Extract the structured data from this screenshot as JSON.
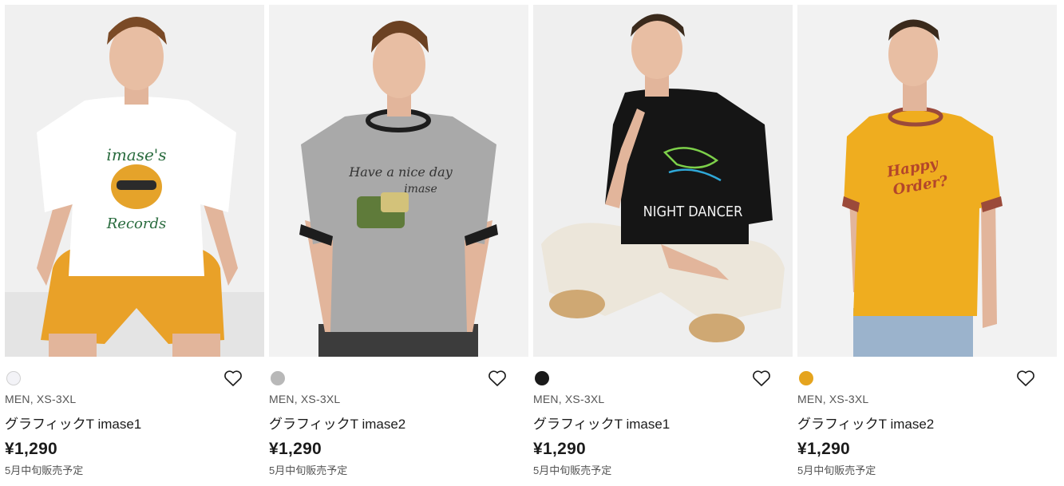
{
  "products": [
    {
      "swatch_color": "#f3f3f7",
      "gender_size": "MEN, XS-3XL",
      "name": "グラフィックT imase1",
      "price": "¥1,290",
      "status": "5月中旬販売予定",
      "image": {
        "shirt_color": "#ffffff",
        "bottom_color": "#e9a128",
        "trim_color": "#ffffff",
        "print_text": "imase's Records",
        "pose": "seated"
      }
    },
    {
      "swatch_color": "#b8b8b8",
      "gender_size": "MEN, XS-3XL",
      "name": "グラフィックT imase2",
      "price": "¥1,290",
      "status": "5月中旬販売予定",
      "image": {
        "shirt_color": "#a9a9a9",
        "bottom_color": "#3c3c3c",
        "trim_color": "#1d1d1d",
        "print_text": "Have a nice day imase",
        "pose": "standing"
      }
    },
    {
      "swatch_color": "#1a1a1a",
      "gender_size": "MEN, XS-3XL",
      "name": "グラフィックT imase1",
      "price": "¥1,290",
      "status": "5月中旬販売予定",
      "image": {
        "shirt_color": "#151515",
        "bottom_color": "#ece6da",
        "trim_color": "#151515",
        "print_text": "NIGHT DANCER",
        "pose": "cross-legged"
      }
    },
    {
      "swatch_color": "#e5a41e",
      "gender_size": "MEN, XS-3XL",
      "name": "グラフィックT imase2",
      "price": "¥1,290",
      "status": "5月中旬販売予定",
      "image": {
        "shirt_color": "#efad1f",
        "bottom_color": "#9bb3cc",
        "trim_color": "#9b4a3a",
        "print_text": "Happy Order?",
        "pose": "standing"
      }
    }
  ]
}
